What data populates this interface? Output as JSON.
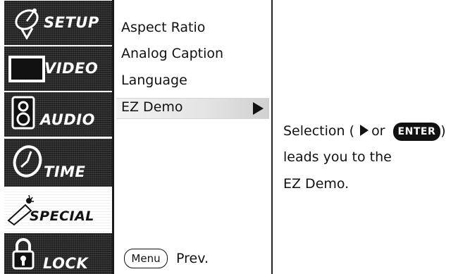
{
  "sidebar": {
    "tabs": [
      {
        "label": "SETUP",
        "icon": "satellite-dish-icon"
      },
      {
        "label": "VIDEO",
        "icon": "screen-icon"
      },
      {
        "label": "AUDIO",
        "icon": "speaker-icon"
      },
      {
        "label": "TIME",
        "icon": "clock-icon"
      },
      {
        "label": "SPECIAL",
        "icon": "magic-wand-icon"
      },
      {
        "label": "LOCK",
        "icon": "padlock-icon"
      }
    ],
    "active_tab": "SPECIAL"
  },
  "menu": {
    "items": [
      "Aspect Ratio",
      "Analog Caption",
      "Language",
      "EZ Demo"
    ],
    "selected_item": "EZ Demo"
  },
  "description": {
    "line1_prefix": "Selection (",
    "line1_or": "or",
    "enter_label": "ENTER",
    "line1_suffix": ")",
    "line2": "leads you to the",
    "line3": "EZ Demo."
  },
  "footer": {
    "menu_button": "Menu",
    "prev_label": "Prev."
  }
}
